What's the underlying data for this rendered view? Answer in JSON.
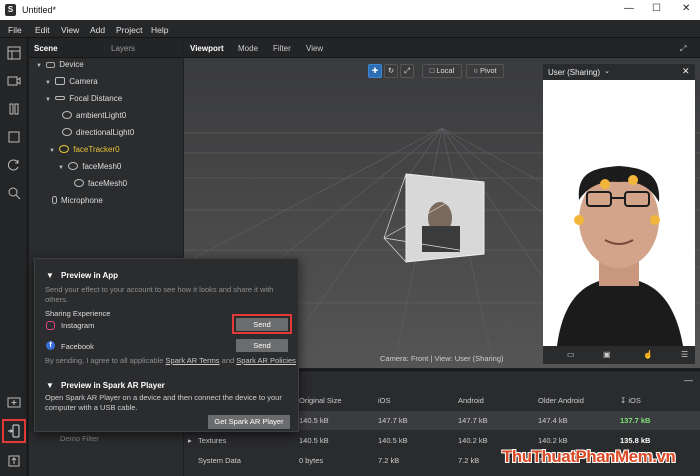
{
  "window": {
    "title": "Untitled*"
  },
  "menu": [
    "File",
    "Edit",
    "View",
    "Add",
    "Project",
    "Help"
  ],
  "scene_panel": {
    "tabs": [
      "Scene",
      "Layers"
    ],
    "tree": [
      "Device",
      "Camera",
      "Focal Distance",
      "ambientLight0",
      "directionalLight0",
      "faceTracker0",
      "faceMesh0",
      "faceMesh0",
      "Microphone"
    ]
  },
  "viewport": {
    "tabs": [
      "Viewport",
      "Mode",
      "Filter",
      "View"
    ],
    "tools": {
      "local": "Local",
      "pivot": "Pivot"
    },
    "camera_label": "Camera: Front | View: User (Sharing)"
  },
  "simulator": {
    "device": "User (Sharing)"
  },
  "preview_popover": {
    "app_title": "Preview in App",
    "app_desc": "Send your effect to your account to see how it looks and share it with others.",
    "sharing_label": "Sharing Experience",
    "instagram": "Instagram",
    "facebook": "Facebook",
    "send": "Send",
    "terms_prefix": "By sending, I agree to all applicable",
    "terms_link1": "Spark AR Terms",
    "terms_and": "and",
    "terms_link2": "Spark AR Policies",
    "player_title": "Preview in Spark AR Player",
    "player_desc": "Open Spark AR Player on a device and then connect the device to your computer with a USB cable.",
    "get_player": "Get Spark AR Player"
  },
  "assets_table": {
    "headers": [
      "Original Size",
      "iOS",
      "Android",
      "Older Android",
      "iOS"
    ],
    "rows": [
      {
        "name": "",
        "original": "140.5 kB",
        "ios": "147.7 kB",
        "android": "147.7 kB",
        "older": "147.4 kB",
        "ios2": "137.7 kB"
      },
      {
        "name": "Textures",
        "original": "140.5 kB",
        "ios": "140.5 kB",
        "android": "140.2 kB",
        "older": "140.2 kB",
        "ios2": "135.8 kB"
      },
      {
        "name": "System Data",
        "original": "0 bytes",
        "ios": "7.2 kB",
        "android": "7.2 kB",
        "older": "7.2 kB",
        "ios2": "1.9 kB"
      }
    ],
    "hidden_row": "Demo Filter"
  },
  "watermark": "ThuThuatPhanMem.vn",
  "colors": {
    "accent": "#2d6fb5",
    "highlight": "#e23a3a",
    "selected_tree": "#e5c33a",
    "good_size": "#7ee27a"
  }
}
